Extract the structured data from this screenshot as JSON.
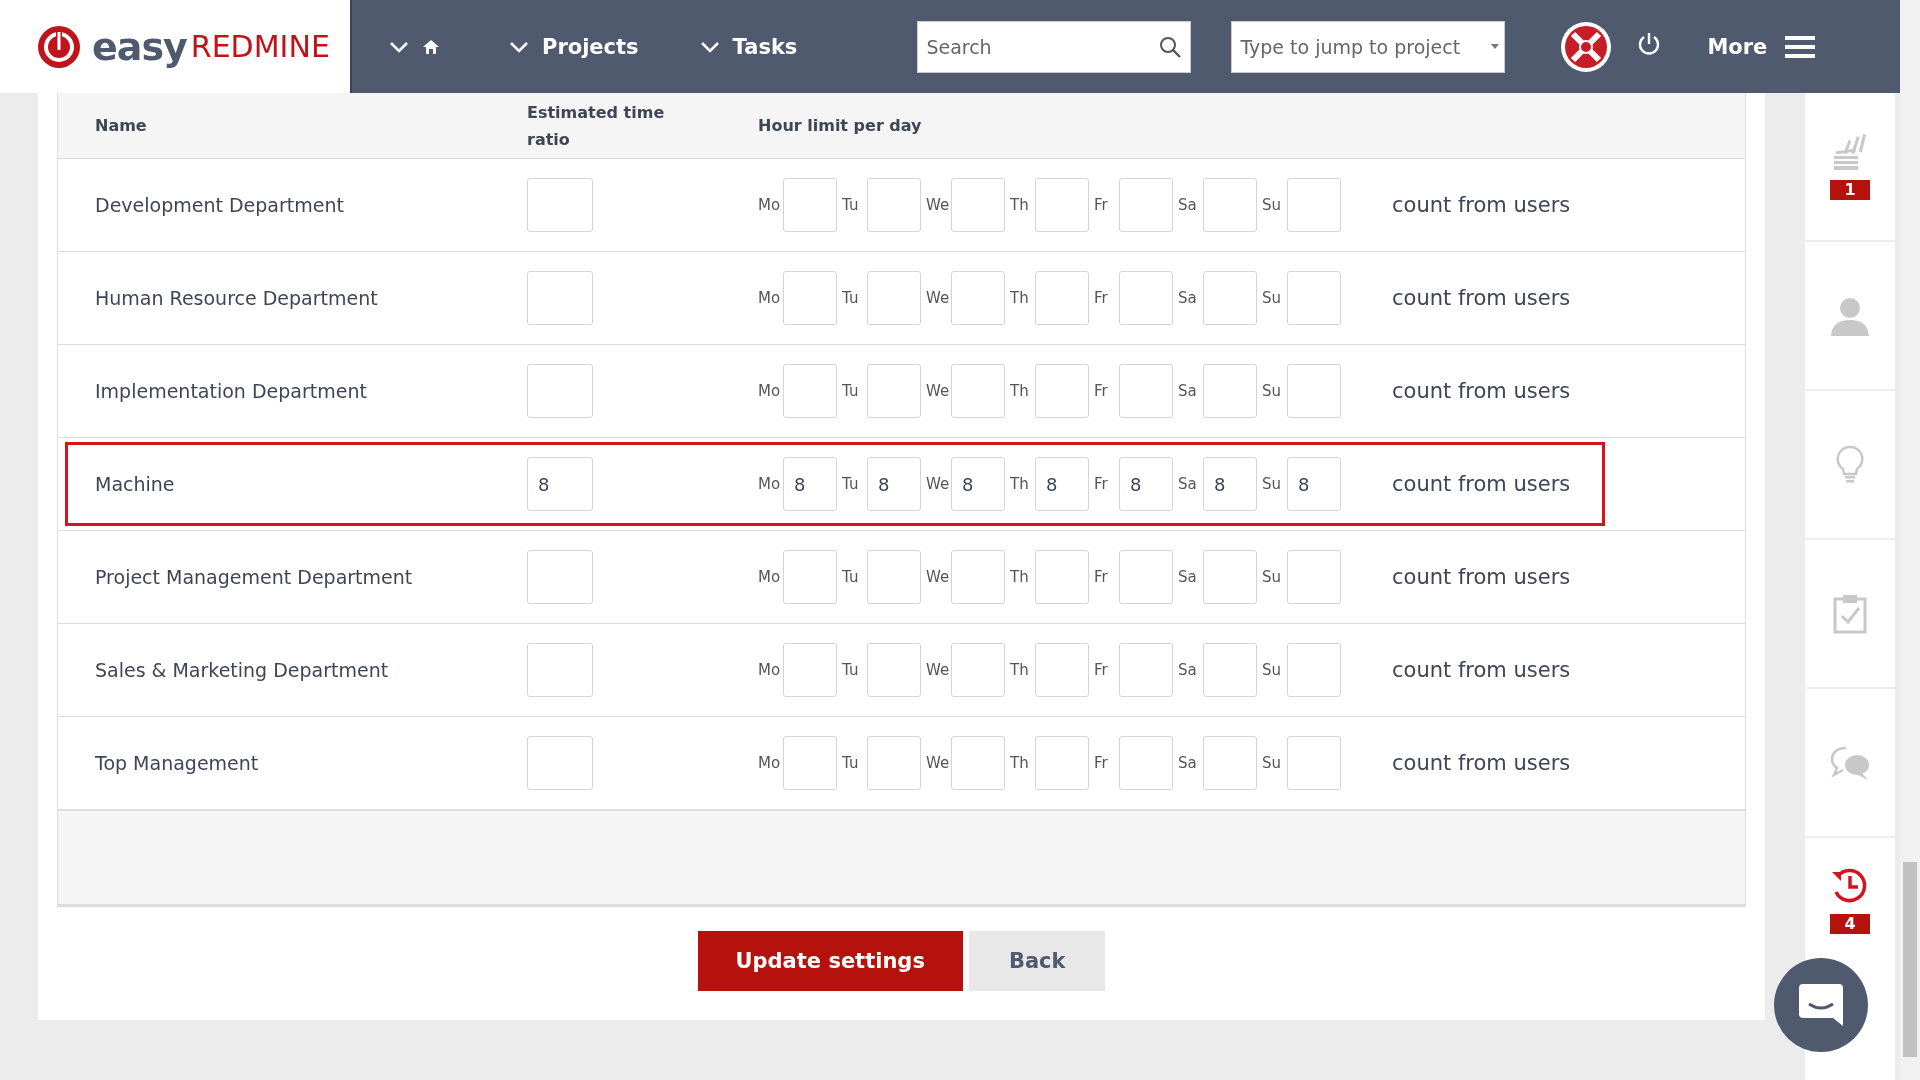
{
  "header": {
    "logo": {
      "easy": "easy",
      "brand": "REDMINE"
    },
    "nav": [
      {
        "kind": "home"
      },
      {
        "kind": "text",
        "label": "Projects"
      },
      {
        "kind": "text",
        "label": "Tasks"
      }
    ],
    "search": {
      "placeholder": "Search"
    },
    "jump": {
      "placeholder": "Type to jump to project"
    },
    "more": "More"
  },
  "table": {
    "columns": [
      "Name",
      "Estimated time ratio",
      "Hour limit per day"
    ],
    "rows": [
      {
        "name": "Development Department",
        "highlighted": false,
        "days": [
          {
            "label": "Mo"
          },
          {
            "label": "Tu"
          },
          {
            "label": "We"
          },
          {
            "label": "Th"
          },
          {
            "label": "Fr"
          },
          {
            "label": "Sa"
          },
          {
            "label": "Su"
          }
        ],
        "note": "count from users"
      },
      {
        "name": "Human Resource Department",
        "highlighted": false,
        "days": [
          {
            "label": "Mo"
          },
          {
            "label": "Tu"
          },
          {
            "label": "We"
          },
          {
            "label": "Th"
          },
          {
            "label": "Fr"
          },
          {
            "label": "Sa"
          },
          {
            "label": "Su"
          }
        ],
        "note": "count from users"
      },
      {
        "name": "Implementation Department",
        "highlighted": false,
        "days": [
          {
            "label": "Mo"
          },
          {
            "label": "Tu"
          },
          {
            "label": "We"
          },
          {
            "label": "Th"
          },
          {
            "label": "Fr"
          },
          {
            "label": "Sa"
          },
          {
            "label": "Su"
          }
        ],
        "note": "count from users"
      },
      {
        "name": "Machine",
        "ratio": "8",
        "highlighted": true,
        "days": [
          {
            "label": "Mo",
            "value": "8"
          },
          {
            "label": "Tu",
            "value": "8"
          },
          {
            "label": "We",
            "value": "8"
          },
          {
            "label": "Th",
            "value": "8"
          },
          {
            "label": "Fr",
            "value": "8"
          },
          {
            "label": "Sa",
            "value": "8"
          },
          {
            "label": "Su",
            "value": "8"
          }
        ],
        "note": "count from users"
      },
      {
        "name": "Project Management Department",
        "highlighted": false,
        "days": [
          {
            "label": "Mo"
          },
          {
            "label": "Tu"
          },
          {
            "label": "We"
          },
          {
            "label": "Th"
          },
          {
            "label": "Fr"
          },
          {
            "label": "Sa"
          },
          {
            "label": "Su"
          }
        ],
        "note": "count from users"
      },
      {
        "name": "Sales & Marketing Department",
        "highlighted": false,
        "days": [
          {
            "label": "Mo"
          },
          {
            "label": "Tu"
          },
          {
            "label": "We"
          },
          {
            "label": "Th"
          },
          {
            "label": "Fr"
          },
          {
            "label": "Sa"
          },
          {
            "label": "Su"
          }
        ],
        "note": "count from users"
      },
      {
        "name": "Top Management",
        "highlighted": false,
        "days": [
          {
            "label": "Mo"
          },
          {
            "label": "Tu"
          },
          {
            "label": "We"
          },
          {
            "label": "Th"
          },
          {
            "label": "Fr"
          },
          {
            "label": "Sa"
          },
          {
            "label": "Su"
          }
        ],
        "note": "count from users"
      }
    ]
  },
  "buttons": [
    {
      "kind": "primary",
      "label": "Update settings"
    },
    {
      "kind": "secondary",
      "label": "Back"
    }
  ],
  "sidebar": [
    {
      "kind": "stack",
      "badge": "1"
    },
    {
      "kind": "user"
    },
    {
      "kind": "bulb"
    },
    {
      "kind": "clipboard"
    },
    {
      "kind": "chat"
    },
    {
      "kind": "history",
      "badge": "4"
    }
  ]
}
